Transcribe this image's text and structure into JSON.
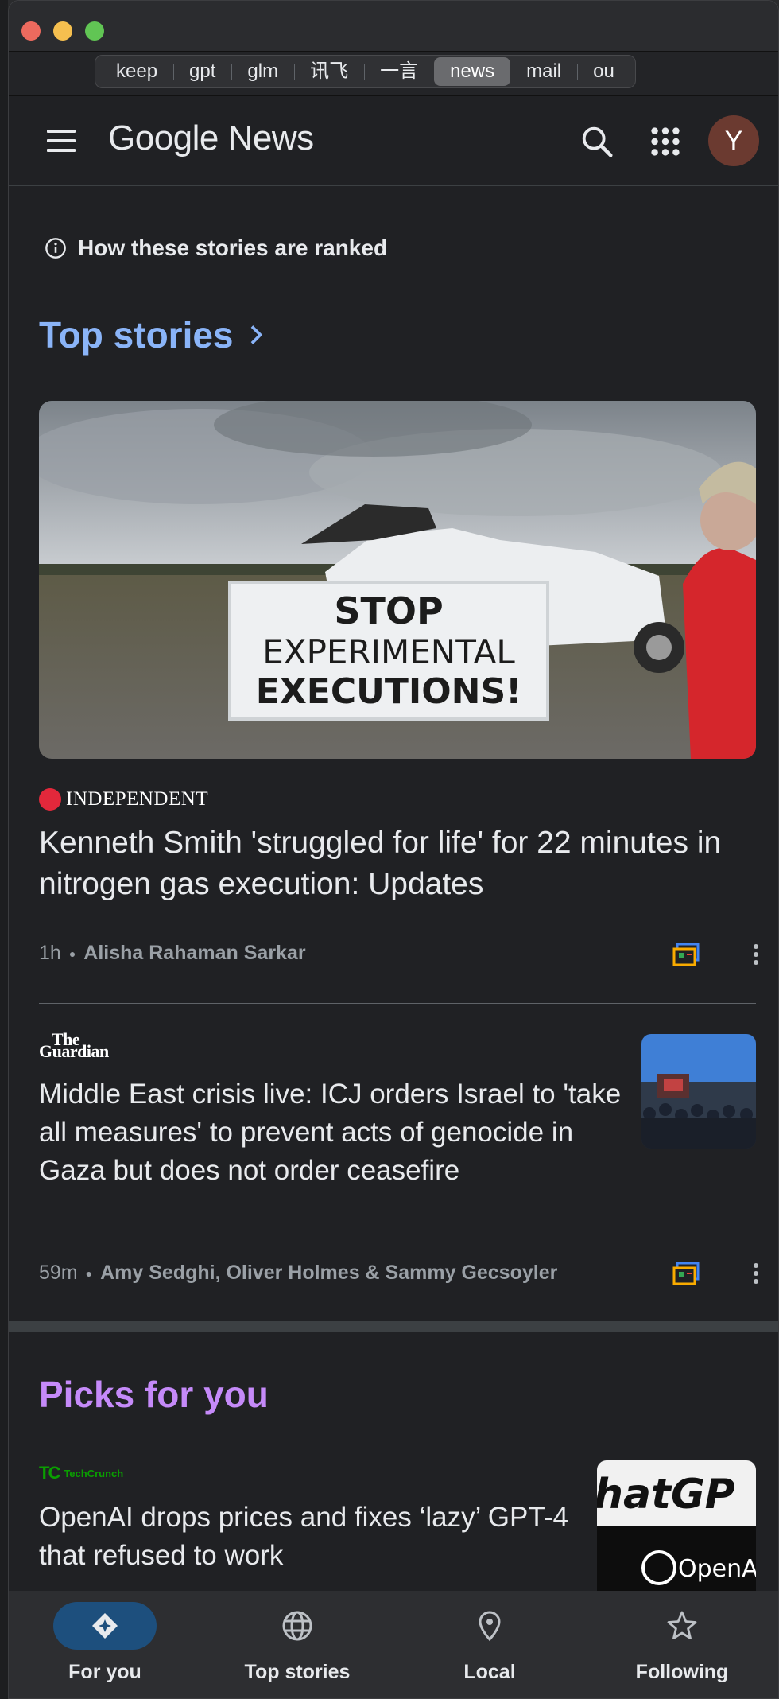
{
  "browser": {
    "tabs": [
      "keep",
      "gpt",
      "glm",
      "讯飞",
      "一言",
      "news",
      "mail",
      "ou"
    ],
    "active_tab": "news"
  },
  "header": {
    "logo_google": "Google",
    "logo_news": "News",
    "avatar_letter": "Y",
    "icons": [
      "menu-icon",
      "search-icon",
      "apps-grid-icon"
    ]
  },
  "ranking_note": "How these stories are ranked",
  "top_stories": {
    "title": "Top stories",
    "articles": [
      {
        "source": "INDEPENDENT",
        "headline": "Kenneth Smith 'struggled for life' for 22 minutes in nitrogen gas execution: Updates",
        "time": "1h",
        "author": "Alisha Rahaman Sarkar",
        "image_sign_lines": [
          "STOP",
          "EXPERIMENTAL",
          "EXECUTIONS!"
        ]
      },
      {
        "source_line1": "The",
        "source_line2": "Guardian",
        "headline": "Middle East crisis live: ICJ orders Israel to 'take all measures' to prevent acts of genocide in Gaza but does not order ceasefire",
        "time": "59m",
        "author": "Amy Sedghi, Oliver Holmes & Sammy Gecsoyler"
      }
    ]
  },
  "picks": {
    "title": "Picks for you",
    "articles": [
      {
        "source_mark": "TC",
        "source": "TechCrunch",
        "headline": "OpenAI drops prices and fixes ‘lazy’ GPT-4 that refused to work",
        "thumb_text_top": "hatGP",
        "thumb_text_bottom": "OpenAI"
      }
    ]
  },
  "bottom_nav": [
    {
      "label": "For you",
      "icon": "for-you-icon",
      "active": true
    },
    {
      "label": "Top stories",
      "icon": "globe-icon",
      "active": false
    },
    {
      "label": "Local",
      "icon": "location-pin-icon",
      "active": false
    },
    {
      "label": "Following",
      "icon": "star-icon",
      "active": false
    }
  ],
  "colors": {
    "background": "#202124",
    "top_stories_accent": "#8ab4f8",
    "picks_accent": "#c58af9",
    "active_nav": "#1d4f7d",
    "independent_red": "#e3283b",
    "techcrunch_green": "#0a9e01"
  }
}
